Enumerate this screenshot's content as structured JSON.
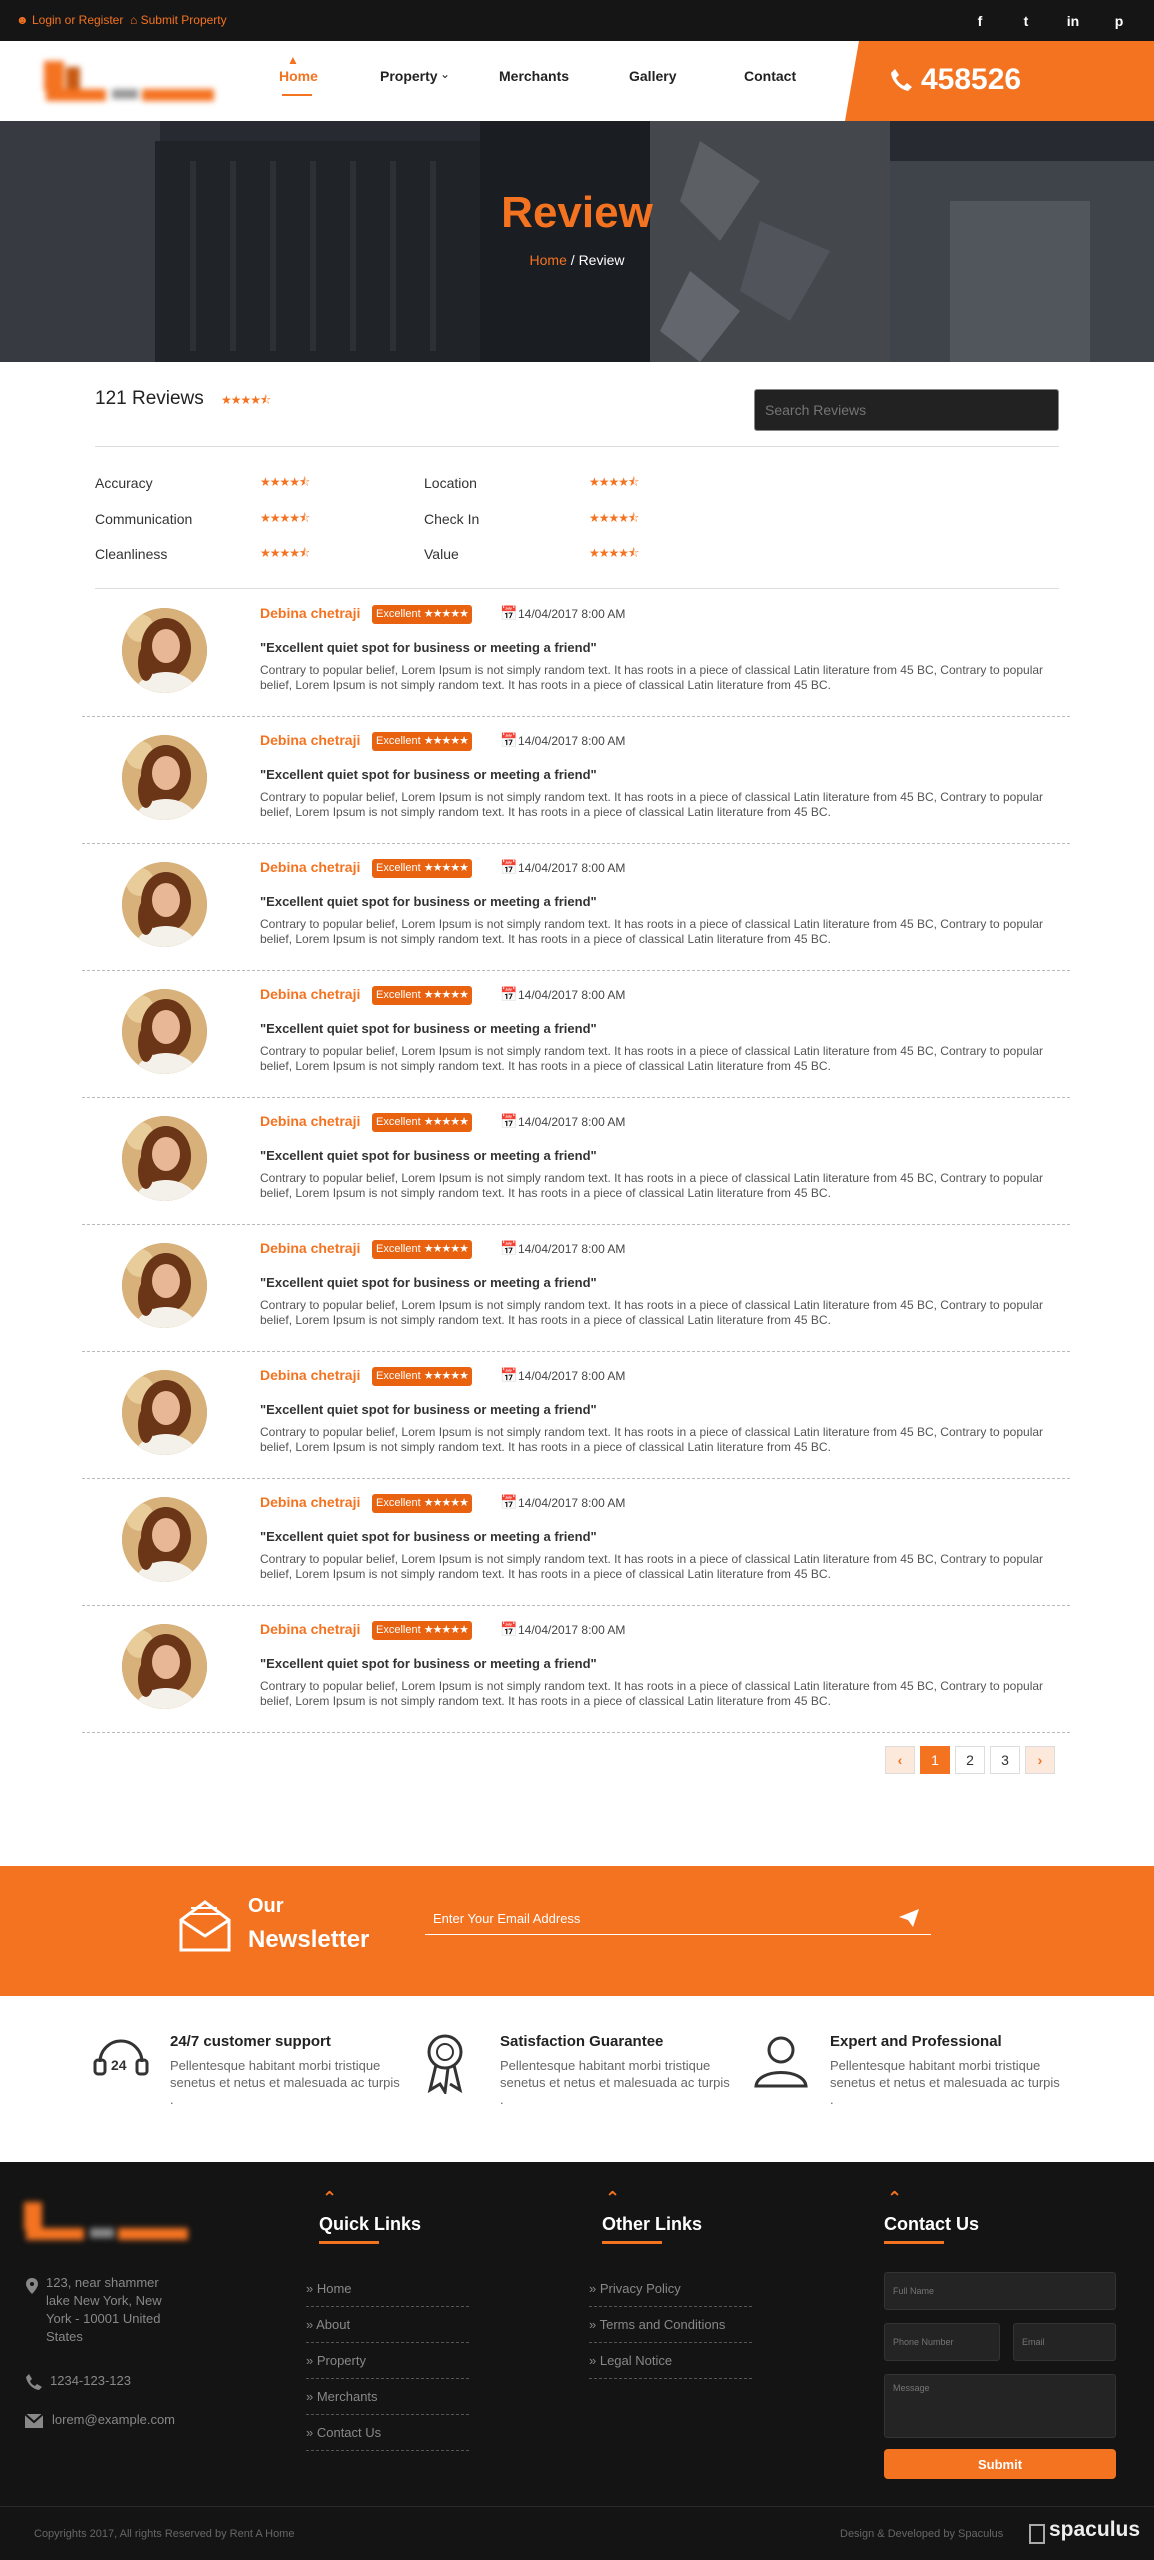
{
  "topbar": {
    "login_label": "Login or Register",
    "submit_label": "Submit Property",
    "social": [
      "f",
      "t",
      "in",
      "p"
    ]
  },
  "header": {
    "logo_alt": "Rent A Home",
    "nav": [
      "Home",
      "Property",
      "Merchants",
      "Gallery",
      "Contact"
    ],
    "phone": "458526"
  },
  "hero": {
    "title": "Review",
    "breadcrumb_home": "Home",
    "breadcrumb_sep": "/",
    "breadcrumb_current": "Review"
  },
  "summary": {
    "count_label": "121 Reviews",
    "rating": 4.5,
    "search_placeholder": "Search Reviews",
    "categories": [
      {
        "label": "Accuracy",
        "rating": 4.5
      },
      {
        "label": "Location",
        "rating": 4.5
      },
      {
        "label": "Communication",
        "rating": 4.5
      },
      {
        "label": "Check In",
        "rating": 4.5
      },
      {
        "label": "Cleanliness",
        "rating": 4.5
      },
      {
        "label": "Value",
        "rating": 4.5
      }
    ]
  },
  "reviews": [
    {
      "name": "Debina chetraji",
      "badge": "Excellent",
      "date": "14/04/2017 8:00 AM",
      "title": "\"Excellent quiet spot for business or meeting a friend\"",
      "body": "Contrary to popular belief, Lorem Ipsum is not simply random text. It has roots in a piece of classical Latin literature from 45 BC, Contrary to popular belief, Lorem Ipsum is not simply random text. It has roots in a piece of classical Latin literature from 45 BC."
    },
    {
      "name": "Debina chetraji",
      "badge": "Excellent",
      "date": "14/04/2017 8:00 AM",
      "title": "\"Excellent quiet spot for business or meeting a friend\"",
      "body": "Contrary to popular belief, Lorem Ipsum is not simply random text. It has roots in a piece of classical Latin literature from 45 BC, Contrary to popular belief, Lorem Ipsum is not simply random text. It has roots in a piece of classical Latin literature from 45 BC."
    },
    {
      "name": "Debina chetraji",
      "badge": "Excellent",
      "date": "14/04/2017 8:00 AM",
      "title": "\"Excellent quiet spot for business or meeting a friend\"",
      "body": "Contrary to popular belief, Lorem Ipsum is not simply random text. It has roots in a piece of classical Latin literature from 45 BC, Contrary to popular belief, Lorem Ipsum is not simply random text. It has roots in a piece of classical Latin literature from 45 BC."
    },
    {
      "name": "Debina chetraji",
      "badge": "Excellent",
      "date": "14/04/2017 8:00 AM",
      "title": "\"Excellent quiet spot for business or meeting a friend\"",
      "body": "Contrary to popular belief, Lorem Ipsum is not simply random text. It has roots in a piece of classical Latin literature from 45 BC, Contrary to popular belief, Lorem Ipsum is not simply random text. It has roots in a piece of classical Latin literature from 45 BC."
    },
    {
      "name": "Debina chetraji",
      "badge": "Excellent",
      "date": "14/04/2017 8:00 AM",
      "title": "\"Excellent quiet spot for business or meeting a friend\"",
      "body": "Contrary to popular belief, Lorem Ipsum is not simply random text. It has roots in a piece of classical Latin literature from 45 BC, Contrary to popular belief, Lorem Ipsum is not simply random text. It has roots in a piece of classical Latin literature from 45 BC."
    },
    {
      "name": "Debina chetraji",
      "badge": "Excellent",
      "date": "14/04/2017 8:00 AM",
      "title": "\"Excellent quiet spot for business or meeting a friend\"",
      "body": "Contrary to popular belief, Lorem Ipsum is not simply random text. It has roots in a piece of classical Latin literature from 45 BC, Contrary to popular belief, Lorem Ipsum is not simply random text. It has roots in a piece of classical Latin literature from 45 BC."
    },
    {
      "name": "Debina chetraji",
      "badge": "Excellent",
      "date": "14/04/2017 8:00 AM",
      "title": "\"Excellent quiet spot for business or meeting a friend\"",
      "body": "Contrary to popular belief, Lorem Ipsum is not simply random text. It has roots in a piece of classical Latin literature from 45 BC, Contrary to popular belief, Lorem Ipsum is not simply random text. It has roots in a piece of classical Latin literature from 45 BC."
    },
    {
      "name": "Debina chetraji",
      "badge": "Excellent",
      "date": "14/04/2017 8:00 AM",
      "title": "\"Excellent quiet spot for business or meeting a friend\"",
      "body": "Contrary to popular belief, Lorem Ipsum is not simply random text. It has roots in a piece of classical Latin literature from 45 BC, Contrary to popular belief, Lorem Ipsum is not simply random text. It has roots in a piece of classical Latin literature from 45 BC."
    },
    {
      "name": "Debina chetraji",
      "badge": "Excellent",
      "date": "14/04/2017 8:00 AM",
      "title": "\"Excellent quiet spot for business or meeting a friend\"",
      "body": "Contrary to popular belief, Lorem Ipsum is not simply random text. It has roots in a piece of classical Latin literature from 45 BC, Contrary to popular belief, Lorem Ipsum is not simply random text. It has roots in a piece of classical Latin literature from 45 BC."
    }
  ],
  "pagination": {
    "prev": "‹",
    "pages": [
      "1",
      "2",
      "3"
    ],
    "current": "1",
    "next": "›"
  },
  "newsletter": {
    "heading_top": "Our",
    "heading_bottom": "Newsletter",
    "placeholder": "Enter Your Email Address"
  },
  "features": [
    {
      "icon": "24h-support-icon",
      "title": "24/7 customer support",
      "text": "Pellentesque habitant morbi tristique senetus et netus et malesuada ac turpis ."
    },
    {
      "icon": "award-ribbon-icon",
      "title": "Satisfaction Guarantee",
      "text": "Pellentesque habitant morbi tristique senetus et netus et malesuada ac turpis ."
    },
    {
      "icon": "person-icon",
      "title": "Expert and Professional",
      "text": "Pellentesque habitant morbi tristique senetus et netus et malesuada ac turpis ."
    }
  ],
  "footer": {
    "address": "123, near shammer lake New York, New York - 10001 United States",
    "phone": "1234-123-123",
    "email": "lorem@example.com",
    "quick_links_title": "Quick Links",
    "quick_links": [
      "Home",
      "About",
      "Property",
      "Merchants",
      "Contact Us"
    ],
    "other_links_title": "Other Links",
    "other_links": [
      "Privacy Policy",
      "Terms and Conditions",
      "Legal Notice"
    ],
    "contact_title": "Contact Us",
    "form": {
      "full_name": "Full Name",
      "phone": "Phone Number",
      "email": "Email",
      "message": "Message",
      "submit": "Submit"
    },
    "copyright": "Copyrights 2017, All rights Reserved by Rent A Home",
    "design": "Design & Developed by Spaculus",
    "spaculus": "spaculus"
  },
  "colors": {
    "accent": "#f47321",
    "dark": "#151515",
    "footer": "#141414"
  }
}
